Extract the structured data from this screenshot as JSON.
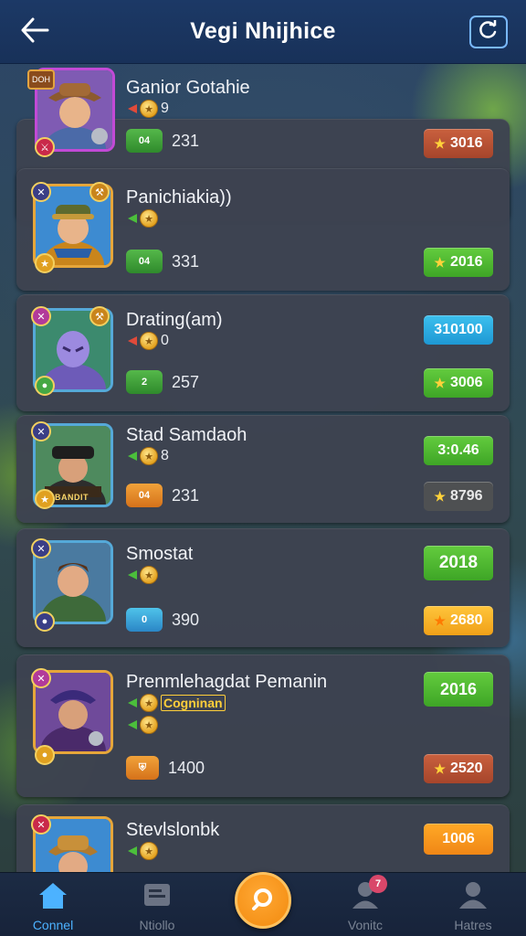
{
  "header": {
    "title": "Vegi Nhijhice",
    "back_icon": "back-arrow-icon",
    "refresh_icon": "refresh-icon"
  },
  "players": [
    {
      "name": "Ganior Gotahie",
      "rank": "9",
      "rank_arrow": "red",
      "stat_badge": "04",
      "stat": "231",
      "price": "3016",
      "price_style": "brick",
      "tag": "",
      "corner_top_text": "DOH",
      "frame": "purple"
    },
    {
      "name": "Panichiakia))",
      "rank": "",
      "rank_arrow": "green",
      "stat_badge": "04",
      "stat": "331",
      "price": "2016",
      "price_style": "green",
      "tag": "",
      "corner_top_text": "",
      "frame": "gold"
    },
    {
      "name": "Drating(am)",
      "rank": "0",
      "rank_arrow": "red",
      "stat_badge": "2",
      "stat": "257",
      "price_top": "310100",
      "price_top_style": "blue",
      "price": "3006",
      "price_style": "green",
      "tag": "",
      "frame": "blue"
    },
    {
      "name": "Stad Samdaoh",
      "rank": "8",
      "rank_arrow": "green",
      "stat_badge": "04",
      "stat": "231",
      "price_top": "3:0.46",
      "price_top_style": "green",
      "price": "8796",
      "price_style": "dark",
      "tag": "",
      "banner": "BANDIT",
      "frame": "blue"
    },
    {
      "name": "Smostat",
      "rank": "",
      "rank_arrow": "green",
      "stat_badge": "0",
      "stat": "390",
      "price_top": "2018",
      "price_top_style": "green",
      "price": "2680",
      "price_style": "gold",
      "tag": "",
      "frame": "blue"
    },
    {
      "name": "Prenmlehagdat Pemanin",
      "rank": "",
      "rank_arrow": "green",
      "stat_badge": "",
      "stat": "1400",
      "price_top": "2016",
      "price_top_style": "green",
      "price": "2520",
      "price_style": "brick",
      "tag": "Cogninan",
      "frame": "gold"
    },
    {
      "name": "Stevlslonbk",
      "rank": "",
      "rank_arrow": "green",
      "price_top": "1006",
      "price_top_style": "orange",
      "frame": "gold"
    }
  ],
  "nav": {
    "items": [
      {
        "label": "Connel",
        "icon": "home-icon",
        "active": true
      },
      {
        "label": "Ntiollo",
        "icon": "document-icon",
        "active": false
      },
      {
        "label": "",
        "icon": "search-icon",
        "active": false
      },
      {
        "label": "Vonitc",
        "icon": "user-notification-icon",
        "active": false,
        "badge": "7"
      },
      {
        "label": "Hatres",
        "icon": "profile-icon",
        "active": false
      }
    ]
  },
  "colors": {
    "header_bg": "#1c3966",
    "card_bg": "#3d4350",
    "accent_blue": "#4cb2ff",
    "accent_orange": "#f28a0e",
    "price_green": "#63cc3e"
  }
}
